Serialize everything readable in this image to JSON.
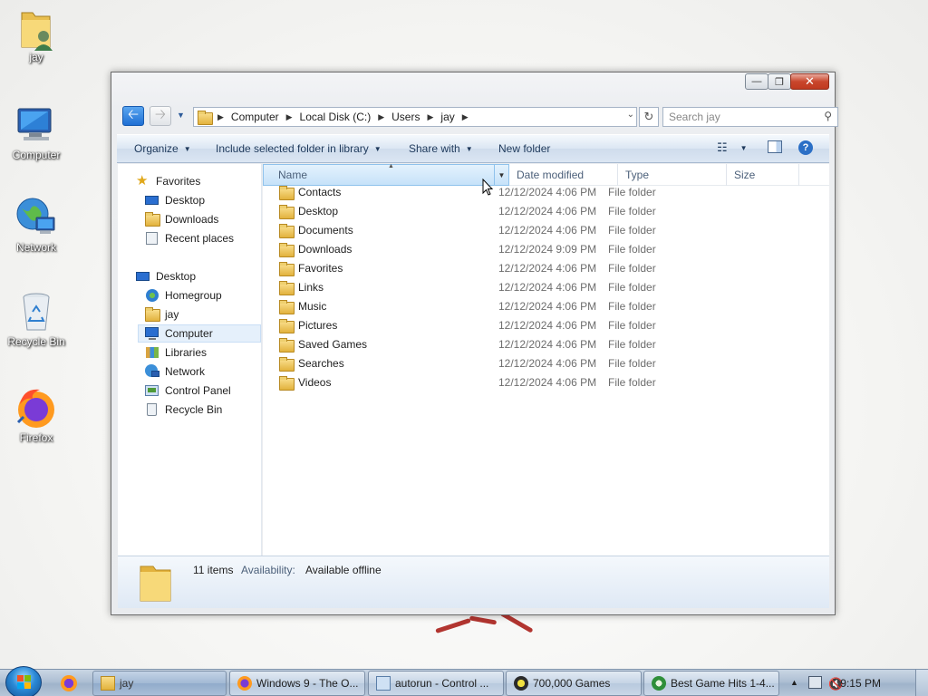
{
  "desktop": {
    "icons": [
      {
        "label": "jay",
        "icon": "user-folder-icon"
      },
      {
        "label": "Computer",
        "icon": "computer-icon"
      },
      {
        "label": "Network",
        "icon": "network-icon"
      },
      {
        "label": "Recycle Bin",
        "icon": "recycle-bin-icon"
      },
      {
        "label": "Firefox",
        "icon": "firefox-icon"
      }
    ]
  },
  "window": {
    "caption_buttons": {
      "minimize": "▭",
      "maximize": "▢",
      "close": "✕"
    },
    "address": {
      "crumbs": [
        "Computer",
        "Local Disk (C:)",
        "Users",
        "jay"
      ]
    },
    "search_placeholder": "Search jay",
    "commands": {
      "organize": "Organize",
      "include": "Include selected folder in library",
      "share": "Share with",
      "new_folder": "New folder"
    },
    "nav_pane": {
      "favorites_header": "Favorites",
      "favorites": [
        "Desktop",
        "Downloads",
        "Recent places"
      ],
      "desktop_header": "Desktop",
      "desktop_items": [
        "Homegroup",
        "jay",
        "Computer",
        "Libraries",
        "Network",
        "Control Panel",
        "Recycle Bin"
      ],
      "selected": "Computer"
    },
    "columns": {
      "name": "Name",
      "date": "Date modified",
      "type": "Type",
      "size": "Size"
    },
    "files": [
      {
        "name": "Contacts",
        "date": "12/12/2024 4:06 PM",
        "type": "File folder"
      },
      {
        "name": "Desktop",
        "date": "12/12/2024 4:06 PM",
        "type": "File folder"
      },
      {
        "name": "Documents",
        "date": "12/12/2024 4:06 PM",
        "type": "File folder"
      },
      {
        "name": "Downloads",
        "date": "12/12/2024 9:09 PM",
        "type": "File folder"
      },
      {
        "name": "Favorites",
        "date": "12/12/2024 4:06 PM",
        "type": "File folder"
      },
      {
        "name": "Links",
        "date": "12/12/2024 4:06 PM",
        "type": "File folder"
      },
      {
        "name": "Music",
        "date": "12/12/2024 4:06 PM",
        "type": "File folder"
      },
      {
        "name": "Pictures",
        "date": "12/12/2024 4:06 PM",
        "type": "File folder"
      },
      {
        "name": "Saved Games",
        "date": "12/12/2024 4:06 PM",
        "type": "File folder"
      },
      {
        "name": "Searches",
        "date": "12/12/2024 4:06 PM",
        "type": "File folder"
      },
      {
        "name": "Videos",
        "date": "12/12/2024 4:06 PM",
        "type": "File folder"
      }
    ],
    "details": {
      "count": "11 items",
      "availability_label": "Availability:",
      "availability_value": "Available offline"
    }
  },
  "taskbar": {
    "buttons": [
      {
        "label": "jay",
        "icon": "folder-icon",
        "active": true
      },
      {
        "label": "Windows 9 - The O...",
        "icon": "firefox-icon",
        "active": false
      },
      {
        "label": "autorun - Control ...",
        "icon": "control-panel-icon",
        "active": false
      },
      {
        "label": "700,000 Games",
        "icon": "games-icon",
        "active": false
      },
      {
        "label": "Best Game Hits 1-4...",
        "icon": "installer-icon",
        "active": false
      }
    ],
    "clock": "9:15 PM",
    "tray_arrow": "▲"
  },
  "colors": {
    "accent": "#1f6fd4",
    "command_bar_text": "#1e395b",
    "secondary_text": "#6d6d6d",
    "selection": "#e5f0fb"
  }
}
